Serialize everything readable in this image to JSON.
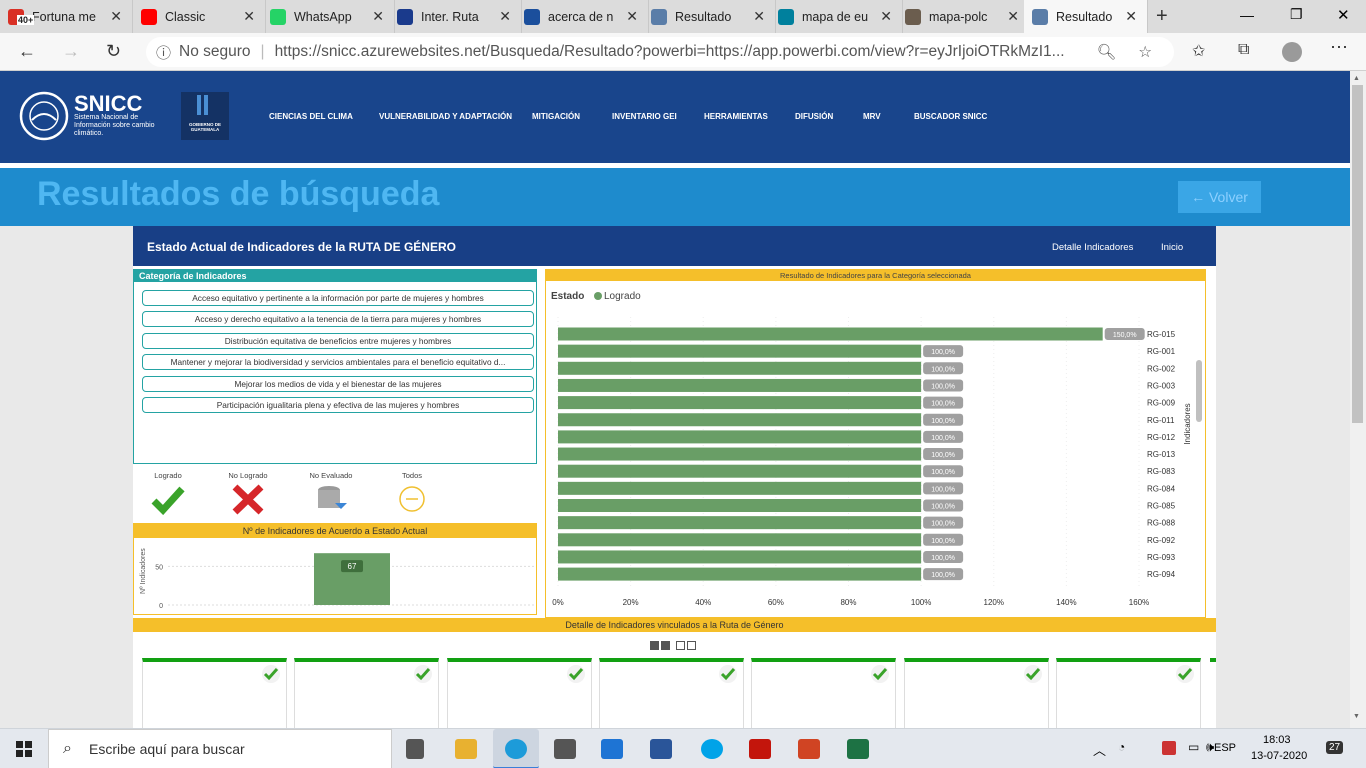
{
  "browser": {
    "tabs": [
      {
        "title": "Fortuna me",
        "color": "#d93025"
      },
      {
        "title": "Classic",
        "color": "#ff0000"
      },
      {
        "title": "WhatsApp",
        "color": "#25d366"
      },
      {
        "title": "Inter. Ruta",
        "color": "#1a3a8c"
      },
      {
        "title": "acerca de n",
        "color": "#1b4f9c"
      },
      {
        "title": "Resultado",
        "color": "#5a7da8"
      },
      {
        "title": "mapa de eu",
        "color": "#00809d"
      },
      {
        "title": "mapa-polc",
        "color": "#6b5d4e"
      },
      {
        "title": "Resultado",
        "color": "#5a7da8"
      }
    ],
    "mail_badge": "40+",
    "not_secure": "No seguro",
    "url": "https://snicc.azurewebsites.net/Busqueda/Resultado?powerbi=https://app.powerbi.com/view?r=eyJrIjoiOTRkMzI1..."
  },
  "site": {
    "logo_text": "SNICC",
    "logo_sub": "Sistema Nacional de Información sobre cambio climático.",
    "gov_label": "GOBIERNO DE GUATEMALA",
    "nav": [
      "CIENCIAS DEL CLIMA",
      "VULNERABILIDAD Y ADAPTACIÓN",
      "MITIGACIÓN",
      "INVENTARIO GEI",
      "HERRAMIENTAS",
      "DIFUSIÓN",
      "MRV",
      "BUSCADOR SNICC"
    ],
    "banner_title": "Resultados de búsqueda",
    "back_button": "← Volver"
  },
  "report": {
    "title": "Estado Actual de Indicadores de la RUTA DE GÉNERO",
    "links": [
      "Detalle Indicadores",
      "Inicio"
    ],
    "category_header": "Categoría de Indicadores",
    "categories": [
      "Acceso equitativo y pertinente a la información por parte de mujeres y hombres",
      "Acceso y derecho equitativo a la tenencia de la tierra para mujeres y hombres",
      "Distribución equitativa de beneficios entre mujeres y hombres",
      "Mantener y mejorar la biodiversidad y servicios ambientales para el beneficio equitativo d...",
      "Mejorar los medios de vida y el bienestar de las mujeres",
      "Participación igualitaria plena y efectiva de las mujeres y hombres"
    ],
    "statuses": [
      {
        "label": "Logrado",
        "icon": "check-icon"
      },
      {
        "label": "No Logrado",
        "icon": "cross-icon"
      },
      {
        "label": "No Evaluado",
        "icon": "database-icon"
      },
      {
        "label": "Todos",
        "icon": "circle-minus-icon"
      }
    ],
    "count_header": "Nº de Indicadores de Acuerdo a Estado Actual",
    "result_header": "Resultado de Indicadores para la Categoría seleccionada",
    "detail_header": "Detalle de Indicadores vinculados a la Ruta de Género",
    "colors": {
      "bar": "#699e66",
      "label_bg": "#a0a0a0",
      "teal": "#24a3a3",
      "yellow": "#f5bf2a",
      "navy": "#183f86"
    }
  },
  "chart_data": [
    {
      "type": "bar",
      "title": "Nº de Indicadores de Acuerdo a Estado Actual",
      "ylabel": "Nº Indicadores",
      "yticks": [
        "50",
        "0"
      ],
      "ylim": [
        0,
        75
      ],
      "values": [
        67
      ],
      "data_labels": [
        "67"
      ]
    },
    {
      "type": "bar",
      "orientation": "horizontal",
      "title": "Resultado de Indicadores para la Categoría seleccionada",
      "legend_title": "Estado",
      "legend": [
        "Logrado"
      ],
      "ylabel": "Indicadores",
      "categories": [
        "RG-015",
        "RG-001",
        "RG-002",
        "RG-003",
        "RG-009",
        "RG-011",
        "RG-012",
        "RG-013",
        "RG-083",
        "RG-084",
        "RG-085",
        "RG-088",
        "RG-092",
        "RG-093",
        "RG-094"
      ],
      "values": [
        150,
        100,
        100,
        100,
        100,
        100,
        100,
        100,
        100,
        100,
        100,
        100,
        100,
        100,
        100
      ],
      "data_labels": [
        "150,0%",
        "100,0%",
        "100,0%",
        "100,0%",
        "100,0%",
        "100,0%",
        "100,0%",
        "100,0%",
        "100,0%",
        "100,0%",
        "100,0%",
        "100,0%",
        "100,0%",
        "100,0%",
        "100,0%"
      ],
      "xticks": [
        "0%",
        "20%",
        "40%",
        "60%",
        "80%",
        "100%",
        "120%",
        "140%",
        "160%"
      ],
      "xlim": [
        0,
        160
      ]
    }
  ],
  "taskbar": {
    "search_placeholder": "Escribe aquí para buscar",
    "lang": "ESP",
    "time": "18:03",
    "date": "13-07-2020",
    "notif_count": "27"
  }
}
